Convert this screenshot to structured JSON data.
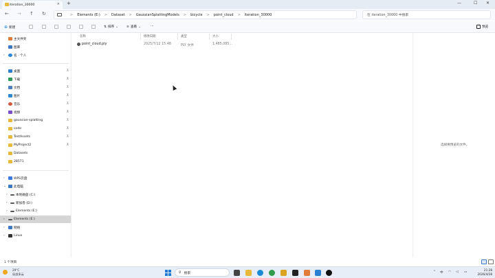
{
  "window": {
    "tab_title": "iteration_30000",
    "tab_close": "×",
    "new_tab": "+",
    "minimize": "—",
    "maximize": "☐",
    "close": "✕"
  },
  "nav": {
    "back": "←",
    "forward": "→",
    "up": "↑",
    "refresh": "↻"
  },
  "breadcrumb": [
    "Elements (E:)",
    "Dataset",
    "GaussianSplattingModels",
    "bicycle",
    "point_cloud",
    "iteration_30000"
  ],
  "breadcrumb_sep": ">",
  "search": {
    "placeholder": "在 iteration_30000 中搜索"
  },
  "toolbar": {
    "new_label": "新建",
    "sort_label": "排序",
    "view_label": "查看",
    "more_label": "···",
    "preview_label": "预览"
  },
  "sidebar": {
    "items": [
      {
        "label": "主文件夹",
        "icon": "home-icon",
        "color": "#e07b39"
      },
      {
        "label": "图库",
        "icon": "gallery-icon",
        "color": "#3b78c4"
      },
      {
        "label": "名 - 个人",
        "icon": "onedrive-icon",
        "color": "#2b88d8"
      },
      {
        "label": "桌面",
        "icon": "desktop-icon",
        "color": "#2f7fd1"
      },
      {
        "label": "下载",
        "icon": "download-icon",
        "color": "#2e9a5a"
      },
      {
        "label": "文档",
        "icon": "documents-icon",
        "color": "#4a7fc1"
      },
      {
        "label": "图片",
        "icon": "pictures-icon",
        "color": "#2e88d0"
      },
      {
        "label": "音乐",
        "icon": "music-icon",
        "color": "#d2563b"
      },
      {
        "label": "视频",
        "icon": "videos-icon",
        "color": "#7a4fc7"
      },
      {
        "label": "gaussian-splatting",
        "icon": "folder-icon",
        "color": "#e8b93b"
      },
      {
        "label": "code",
        "icon": "folder-icon",
        "color": "#e8b93b"
      },
      {
        "label": "TestAssets",
        "icon": "folder-icon",
        "color": "#e8b93b"
      },
      {
        "label": "MyProject2",
        "icon": "folder-icon",
        "color": "#e8b93b"
      },
      {
        "label": "Datasets",
        "icon": "folder-icon",
        "color": "#e8b93b"
      },
      {
        "label": "28571",
        "icon": "folder-icon",
        "color": "#e8b93b"
      },
      {
        "label": "WPS云盘",
        "icon": "wps-cloud-icon",
        "color": "#3a7be0"
      },
      {
        "label": "此电脑",
        "icon": "this-pc-icon",
        "color": "#3b78c4"
      },
      {
        "label": "本地磁盘 (C:)",
        "icon": "drive-icon",
        "color": "#555555"
      },
      {
        "label": "新加卷 (D:)",
        "icon": "drive-icon",
        "color": "#555555"
      },
      {
        "label": "Elements (E:)",
        "icon": "drive-icon",
        "color": "#555555"
      },
      {
        "label": "Elements (E:)",
        "icon": "drive-icon",
        "color": "#555555"
      },
      {
        "label": "网络",
        "icon": "network-icon",
        "color": "#3b78c4"
      },
      {
        "label": "Linux",
        "icon": "linux-icon",
        "color": "#333333"
      }
    ],
    "pin": "⊼",
    "chev_right": "›",
    "chev_down": "⌄"
  },
  "columns": [
    "名称",
    "修改日期",
    "类型",
    "大小"
  ],
  "files": [
    {
      "name": "point_cloud.ply",
      "modified": "2025/7/12 15:48",
      "type": "PLY 文件",
      "size": "1,485,085..."
    }
  ],
  "preview_pane": {
    "message": "选择要预览的文件。"
  },
  "status": {
    "item_count": "1 个项目"
  },
  "taskbar": {
    "temperature": "29°C",
    "weather": "局部多云",
    "search_label": "搜索",
    "time": "21:28",
    "date": "2026/4/28",
    "tray_lang": "中"
  },
  "colors": {
    "accent": "#1e7ad6",
    "selected": "#d5d5d5",
    "folder": "#e8b93b"
  }
}
